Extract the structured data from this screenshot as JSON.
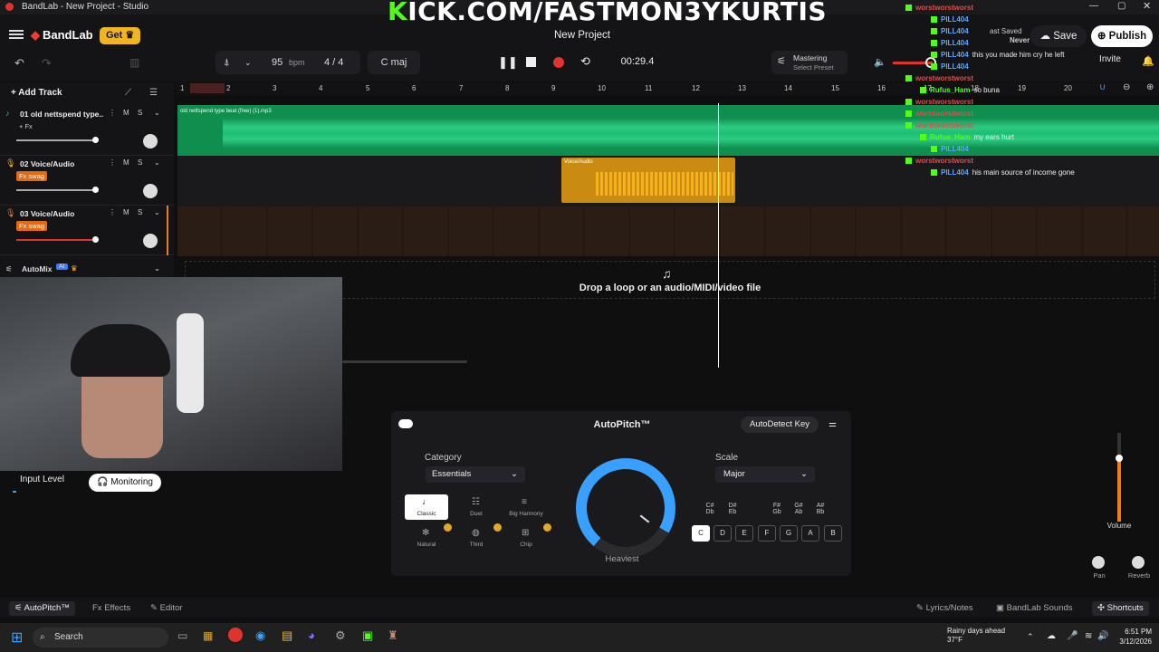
{
  "window": {
    "title": "BandLab - New Project - Studio"
  },
  "overlay": {
    "kick_url": "ICK.COM/FASTMON3YKURTIS"
  },
  "header": {
    "logo": "BandLab",
    "get_label": "Get",
    "project_name": "New Project",
    "last_saved_label": "ast Saved",
    "last_saved_value": "Never",
    "save_label": "Save",
    "publish_label": "Publish"
  },
  "toolbar": {
    "bpm": "95",
    "bpm_unit": "bpm",
    "time_sig": "4 / 4",
    "key": "C maj",
    "time": "00:29.4",
    "mastering": "Mastering",
    "select_preset": "Select Preset",
    "invite": "Invite"
  },
  "tracks": {
    "add_track": "Add Track",
    "items": [
      {
        "num": "01",
        "name": "old nettspend type...",
        "fx": "+ Fx",
        "fx_active": false
      },
      {
        "num": "02",
        "name": "Voice/Audio",
        "fx": "Fx swag",
        "fx_active": true
      },
      {
        "num": "03",
        "name": "Voice/Audio",
        "fx": "Fx swag",
        "fx_active": true
      }
    ],
    "mute": "M",
    "solo": "S",
    "automix": "AutoMix",
    "ai_badge": "AI"
  },
  "ruler": {
    "bars": [
      "1",
      "2",
      "3",
      "4",
      "5",
      "6",
      "7",
      "8",
      "9",
      "10",
      "11",
      "12",
      "13",
      "14",
      "15",
      "16",
      "17",
      "18",
      "19",
      "20"
    ]
  },
  "clips": {
    "clip1_label": "old nettspend type beat (free) (1).mp3",
    "clip2_label": "Voice/Audio"
  },
  "dropzone": {
    "text": "Drop a loop or an audio/MIDI/video file"
  },
  "webcam": {
    "input_level": "Input Level",
    "monitoring": "Monitoring"
  },
  "autopitch": {
    "title": "AutoPitch™",
    "autodetect": "AutoDetect Key",
    "category_label": "Category",
    "category_value": "Essentials",
    "presets": [
      "Classic",
      "Duet",
      "Big Harmony",
      "Natural",
      "Third",
      "Chip"
    ],
    "dial_label": "Heaviest",
    "scale_label": "Scale",
    "scale_value": "Major",
    "sharps": [
      "C# Db",
      "D# Eb",
      "F# Gb",
      "G# Ab",
      "A# Bb"
    ],
    "notes": [
      "C",
      "D",
      "E",
      "F",
      "G",
      "A",
      "B"
    ],
    "accent": "#3aa0ff"
  },
  "mixer": {
    "volume": "Volume",
    "pan": "Pan",
    "reverb": "Reverb",
    "volume_level": 0.7
  },
  "bottom_tabs": {
    "autopitch": "AutoPitch™",
    "effects": "Effects",
    "editor": "Editor",
    "lyrics": "Lyrics/Notes",
    "sounds": "BandLab Sounds",
    "shortcuts": "Shortcuts"
  },
  "chat": [
    {
      "user": "worstworstworst",
      "color": "red",
      "msg": ""
    },
    {
      "user": "PILL404",
      "color": "blue",
      "msg": ""
    },
    {
      "user": "PILL404",
      "color": "blue",
      "msg": ""
    },
    {
      "user": "PILL404",
      "color": "blue",
      "msg": ""
    },
    {
      "user": "PILL404",
      "color": "blue",
      "msg": "this you made him cry he left"
    },
    {
      "user": "PILL404",
      "color": "blue",
      "msg": ""
    },
    {
      "user": "worstworstworst",
      "color": "red",
      "msg": ""
    },
    {
      "user": "Rufus_Ham",
      "color": "green",
      "msg": "so buna"
    },
    {
      "user": "worstworstworst",
      "color": "red",
      "msg": ""
    },
    {
      "user": "worstworstworst",
      "color": "red",
      "msg": ""
    },
    {
      "user": "worstworstworst",
      "color": "red",
      "msg": ""
    },
    {
      "user": "Rufus_Ham",
      "color": "green",
      "msg": "my ears hurt"
    },
    {
      "user": "PILL404",
      "color": "blue",
      "msg": ""
    },
    {
      "user": "worstworstworst",
      "color": "red",
      "msg": ""
    },
    {
      "user": "PILL404",
      "color": "blue",
      "msg": "his main source of income gone"
    }
  ],
  "taskbar": {
    "search": "Search",
    "weather_title": "Rainy days ahead",
    "weather_temp": "37°F",
    "time": "6:51 PM",
    "date": "3/12/2026"
  }
}
